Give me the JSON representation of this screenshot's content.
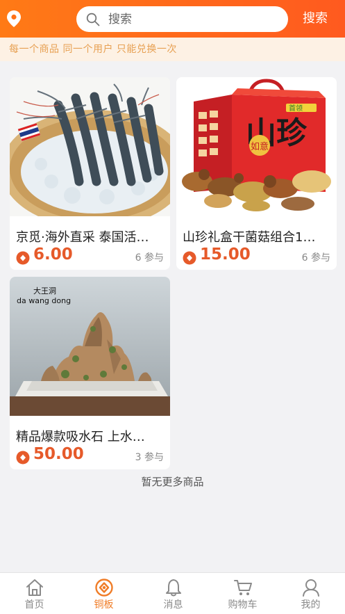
{
  "header": {
    "search_placeholder": "搜索",
    "search_button": "搜索"
  },
  "notice": "每一个商品 同一个用户 只能兑换一次",
  "products": [
    {
      "title": "京觅·海外直采 泰国活…",
      "price": "6.00",
      "joined": "6 参与",
      "image": "shrimp"
    },
    {
      "title": "山珍礼盒干菌菇组合1…",
      "price": "15.00",
      "joined": "6 参与",
      "image": "mushroom-gift-box"
    },
    {
      "title": "精品爆款吸水石 上水…",
      "price": "50.00",
      "joined": "3 参与",
      "image": "rockery-bonsai"
    }
  ],
  "box_text": {
    "big": "山珍",
    "seal": "如意",
    "brand": "首领",
    "rock_cn": "大王洞",
    "rock_en": "da wang dong"
  },
  "no_more": "暂无更多商品",
  "tabs": [
    {
      "label": "首页",
      "icon": "home-icon",
      "active": false
    },
    {
      "label": "铜板",
      "icon": "coin-icon",
      "active": true
    },
    {
      "label": "消息",
      "icon": "bell-icon",
      "active": false
    },
    {
      "label": "购物车",
      "icon": "cart-icon",
      "active": false
    },
    {
      "label": "我的",
      "icon": "user-icon",
      "active": false
    }
  ],
  "colors": {
    "header_start": "#ff7a16",
    "header_end": "#ff5a1f",
    "price": "#e65a2a",
    "tab_active": "#f07d28",
    "notice_text": "#e7a052",
    "notice_bg": "#fdf1e4"
  }
}
